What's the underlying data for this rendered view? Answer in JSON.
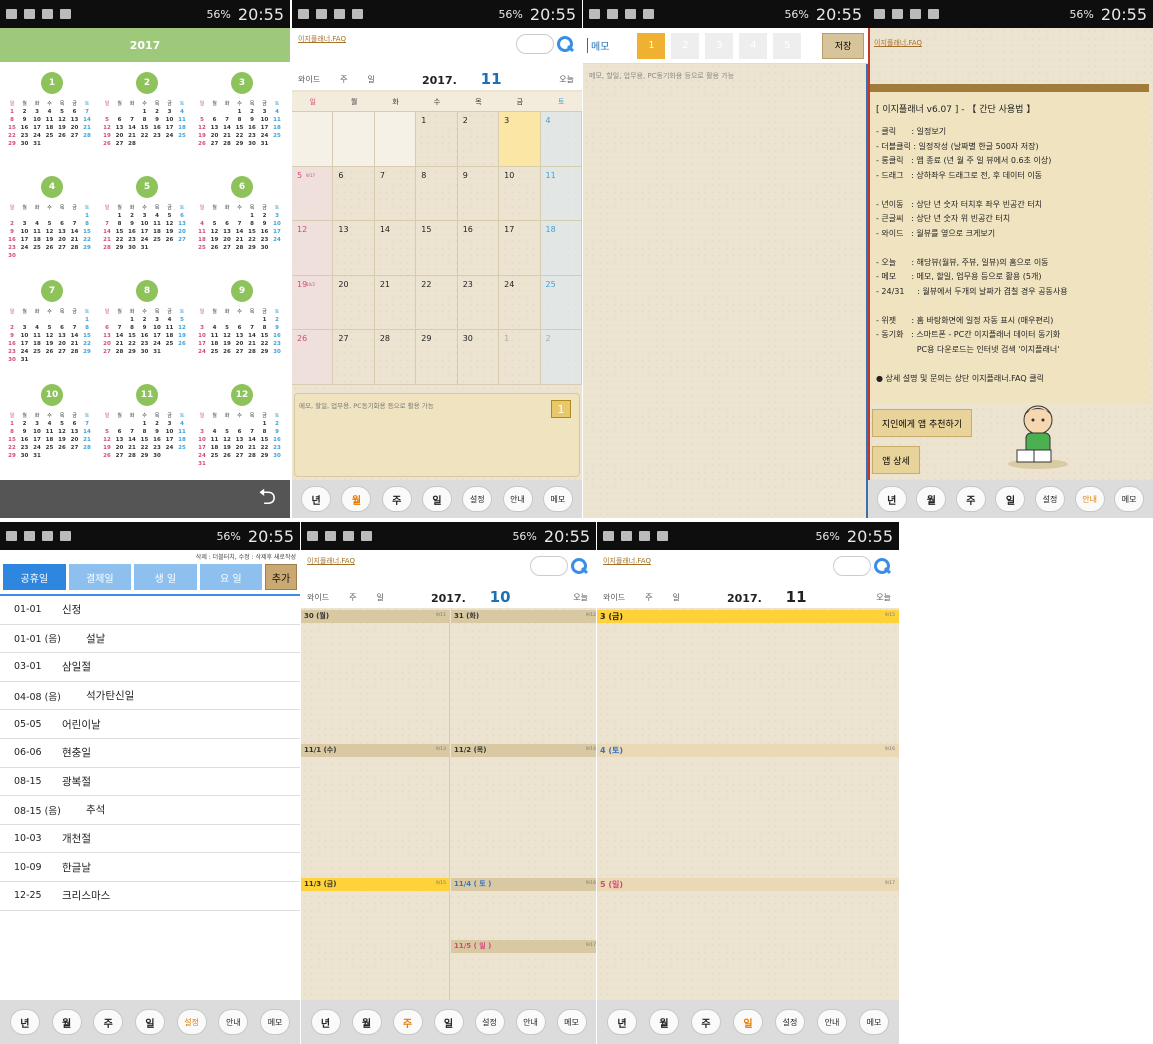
{
  "statusbar": {
    "battery": "56%",
    "time": "20:55"
  },
  "year_view": {
    "title": "2017",
    "wd": [
      "일",
      "월",
      "화",
      "수",
      "목",
      "금",
      "토"
    ],
    "months": [
      {
        "n": "1",
        "off": 0,
        "days": 31
      },
      {
        "n": "2",
        "off": 3,
        "days": 28
      },
      {
        "n": "3",
        "off": 3,
        "days": 31
      },
      {
        "n": "4",
        "off": 6,
        "days": 30
      },
      {
        "n": "5",
        "off": 1,
        "days": 31
      },
      {
        "n": "6",
        "off": 4,
        "days": 30
      },
      {
        "n": "7",
        "off": 6,
        "days": 31
      },
      {
        "n": "8",
        "off": 2,
        "days": 31
      },
      {
        "n": "9",
        "off": 5,
        "days": 30
      },
      {
        "n": "10",
        "off": 0,
        "days": 31
      },
      {
        "n": "11",
        "off": 3,
        "days": 30
      },
      {
        "n": "12",
        "off": 5,
        "days": 31
      }
    ]
  },
  "month_view": {
    "faq": "이지플래너.FAQ",
    "nav": [
      "와이드",
      "주",
      "일"
    ],
    "year": "2017.",
    "month": "11",
    "today": "오늘",
    "weekdays": [
      "일",
      "월",
      "화",
      "수",
      "목",
      "금",
      "토"
    ],
    "weeks": [
      [
        "",
        "",
        "",
        "1",
        "2",
        "3",
        "4"
      ],
      [
        "5",
        "6",
        "7",
        "8",
        "9",
        "10",
        "11"
      ],
      [
        "12",
        "13",
        "14",
        "15",
        "16",
        "17",
        "18"
      ],
      [
        "19",
        "20",
        "21",
        "22",
        "23",
        "24",
        "25"
      ],
      [
        "26",
        "27",
        "28",
        "29",
        "30",
        "1",
        "2"
      ]
    ],
    "subs": {
      "5": "9/17",
      "19": "10/2"
    },
    "memo_placeholder": "메모, 할일, 업무용, PC동기화용 등으로 활용 가능"
  },
  "memo_panel": {
    "label": "메모",
    "tabs": [
      "1",
      "2",
      "3",
      "4",
      "5"
    ],
    "save": "저장",
    "placeholder": "메모, 할일, 업무용, PC동기화용 등으로 활용 가능"
  },
  "help_panel": {
    "faq": "이지플래너.FAQ",
    "title": "[ 이지플래너 v6.07 ]  -  【 간단 사용법 】",
    "lines": [
      "- 클릭      : 일정보기",
      "- 더블클릭 : 일정작성 (날짜별 한글 500자 저장)",
      "- 롱클릭   : 앱 종료 (년 월 주 일 뷰에서 0.6초 이상)",
      "- 드래그   : 상하좌우 드래그로 전, 후 데이터 이동",
      "",
      "- 년이동   : 상단 년 숫자 터치후 좌우 빈공간 터치",
      "- 큰글씨   : 상단 년 숫자 위 빈공간 터치",
      "- 와이드   : 월뷰를 옆으로 크게보기",
      "",
      "- 오늘      : 해당뷰(월뷰, 주뷰, 일뷰)의 홈으로 이동",
      "- 메모      : 메모, 할일, 업무용 등으로 활용 (5개)",
      "- 24/31     : 월뷰에서 두개의 날짜가 겹칠 경우 공동사용",
      "",
      "- 위젯      : 홈 바탕화면에 일정 자동 표시 (매우편리)",
      "- 동기화   : 스마트폰 - PC간 이지플래너 데이터 동기화",
      "                PC용 다운로드는 인터넷 검색 '이지플래너'",
      "",
      "● 상세 설명 및 문의는 상단 이지플래너.FAQ 클릭"
    ],
    "recommend": "지인에게 앱 추천하기",
    "detail": "앱 상세"
  },
  "holiday_view": {
    "hint": "삭제 : 더블터치, 수정 : 삭제후 새로작성",
    "tabs": [
      "공휴일",
      "결제일",
      "생 일",
      "요 일"
    ],
    "add": "추가",
    "rows": [
      [
        "01-01",
        "신정"
      ],
      [
        "01-01 (음)",
        "설날"
      ],
      [
        "03-01",
        "삼일절"
      ],
      [
        "04-08 (음)",
        "석가탄신일"
      ],
      [
        "05-05",
        "어린이날"
      ],
      [
        "06-06",
        "현충일"
      ],
      [
        "08-15",
        "광복절"
      ],
      [
        "08-15 (음)",
        "추석"
      ],
      [
        "10-03",
        "개천절"
      ],
      [
        "10-09",
        "한글날"
      ],
      [
        "12-25",
        "크리스마스"
      ]
    ]
  },
  "week_view": {
    "faq": "이지플래너.FAQ",
    "nav": [
      "와이드",
      "주",
      "일"
    ],
    "year": "2017.",
    "month": "10",
    "today": "오늘",
    "cells": [
      {
        "d": "30 (월)",
        "s": "9/11"
      },
      {
        "d": "31 (화)",
        "s": "9/12"
      },
      {
        "d": "11/1 (수)",
        "s": "9/13"
      },
      {
        "d": "11/2 (목)",
        "s": "9/14"
      },
      {
        "d": "11/3 (금)",
        "s": "9/15"
      },
      {
        "d": "11/4 ( 토 )",
        "s": "9/16"
      },
      {
        "d": "11/5 ( 일 )",
        "s": "9/17"
      }
    ]
  },
  "day_view": {
    "faq": "이지플래너.FAQ",
    "nav": [
      "와이드",
      "주",
      "일"
    ],
    "year": "2017.",
    "month": "11",
    "today": "오늘",
    "days": [
      {
        "d": "3 (금)",
        "s": "9/15"
      },
      {
        "d": "4 (토)",
        "s": "9/16"
      },
      {
        "d": "5 (일)",
        "s": "9/17"
      }
    ]
  },
  "buttons": [
    "년",
    "월",
    "주",
    "일",
    "설정",
    "안내",
    "메모"
  ]
}
